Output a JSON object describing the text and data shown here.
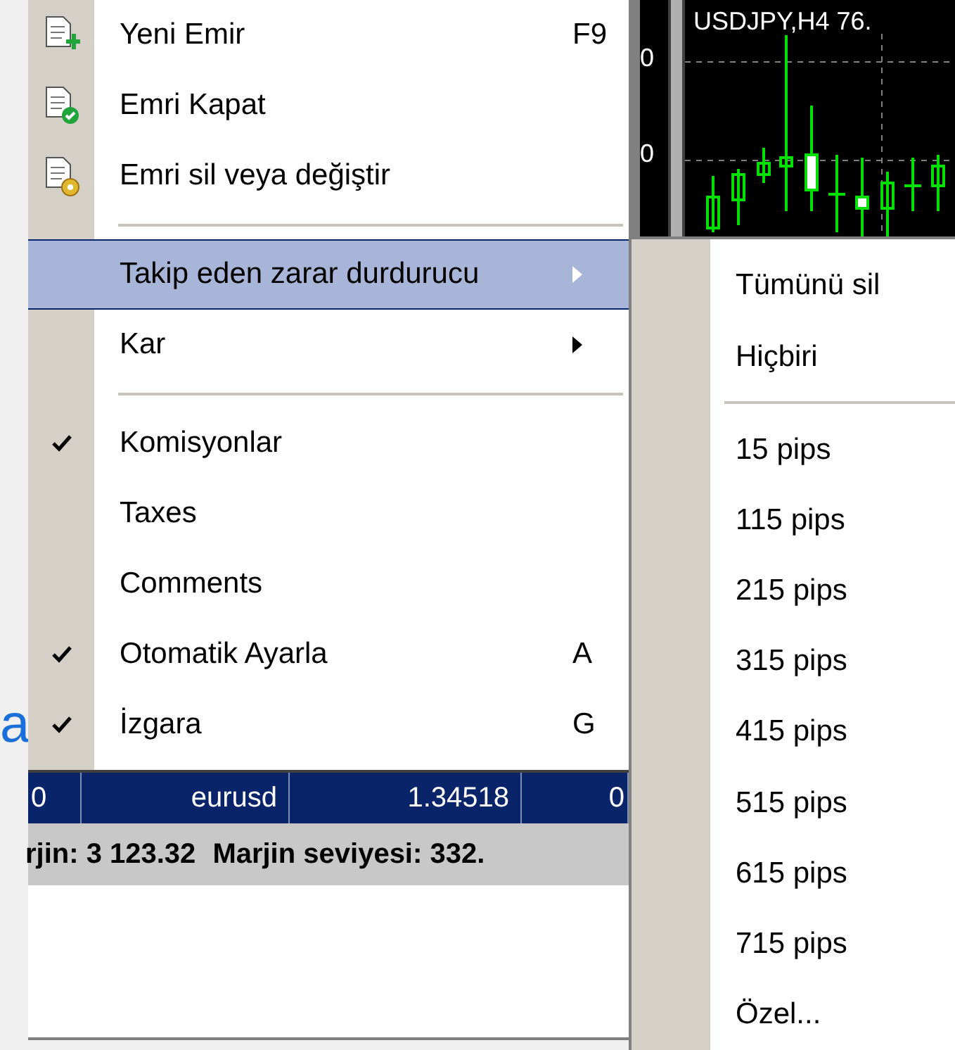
{
  "background_text": "a",
  "chart": {
    "title": "USDJPY,H4 76.",
    "axis_labels": [
      "0",
      "0"
    ]
  },
  "menu": {
    "items": [
      {
        "kind": "item",
        "label": "Yeni Emir",
        "shortcut": "F9",
        "checked": false,
        "selected": false,
        "submenu": false
      },
      {
        "kind": "item",
        "label": "Emri Kapat",
        "checked": false,
        "selected": false,
        "submenu": false
      },
      {
        "kind": "item",
        "label": "Emri sil veya değiştir",
        "checked": false,
        "selected": false,
        "submenu": false
      },
      {
        "kind": "separator"
      },
      {
        "kind": "item",
        "label": "Takip eden zarar durdurucu",
        "checked": false,
        "selected": true,
        "submenu": true
      },
      {
        "kind": "item",
        "label": "Kar",
        "checked": false,
        "selected": false,
        "submenu": true
      },
      {
        "kind": "separator"
      },
      {
        "kind": "item",
        "label": "Komisyonlar",
        "checked": true,
        "selected": false,
        "submenu": false
      },
      {
        "kind": "item",
        "label": "Taxes",
        "checked": false,
        "selected": false,
        "submenu": false
      },
      {
        "kind": "item",
        "label": "Comments",
        "checked": false,
        "selected": false,
        "submenu": false
      },
      {
        "kind": "item",
        "label": "Otomatik Ayarla",
        "shortcut": "A",
        "checked": true,
        "selected": false,
        "submenu": false
      },
      {
        "kind": "item",
        "label": "İzgara",
        "shortcut": "G",
        "checked": true,
        "selected": false,
        "submenu": false
      }
    ]
  },
  "submenu": {
    "items": [
      {
        "kind": "item",
        "label": "Tümünü sil",
        "selected": false
      },
      {
        "kind": "item",
        "label": "Hiçbiri",
        "selected": false
      },
      {
        "kind": "separator"
      },
      {
        "kind": "item",
        "label": "15 pips",
        "selected": false
      },
      {
        "kind": "item",
        "label": "115 pips",
        "selected": false
      },
      {
        "kind": "item",
        "label": "215 pips",
        "selected": false
      },
      {
        "kind": "item",
        "label": "315 pips",
        "selected": false
      },
      {
        "kind": "item",
        "label": "415 pips",
        "selected": false
      },
      {
        "kind": "item",
        "label": "515 pips",
        "selected": false
      },
      {
        "kind": "item",
        "label": "615 pips",
        "selected": false
      },
      {
        "kind": "item",
        "label": "715 pips",
        "selected": false
      },
      {
        "kind": "item",
        "label": "Özel...",
        "selected": false
      }
    ]
  },
  "table": {
    "rows": [
      {
        "cells": [
          "0",
          "eurusd",
          "1.34518",
          "0"
        ],
        "selected": true
      }
    ]
  },
  "status_bar": [
    "rjin: 3 123.32",
    "Marjin seviyesi: 332."
  ]
}
